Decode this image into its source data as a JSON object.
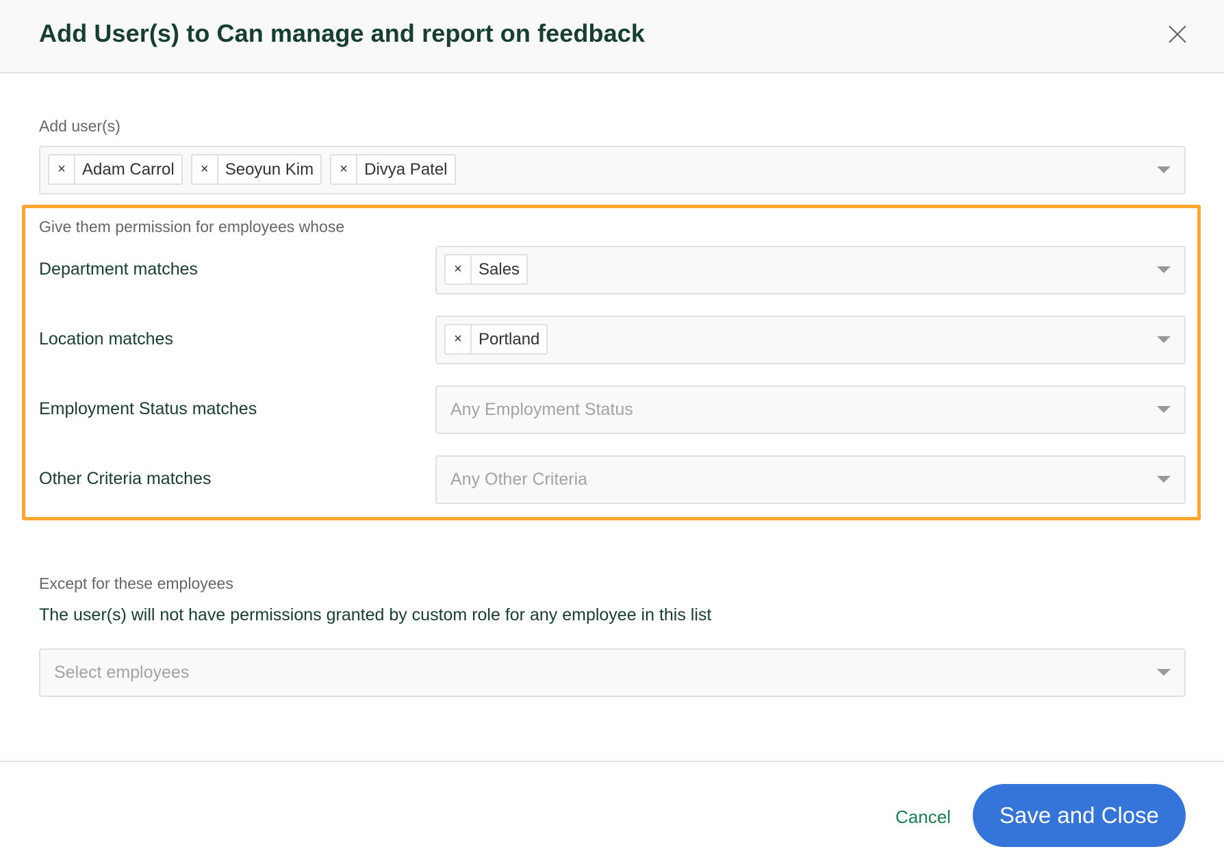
{
  "modal": {
    "title": "Add User(s) to Can manage and report on feedback",
    "close_icon": "close-icon"
  },
  "add_users": {
    "label": "Add user(s)",
    "selected": [
      {
        "name": "Adam Carrol",
        "remove": "×"
      },
      {
        "name": "Seoyun Kim",
        "remove": "×"
      },
      {
        "name": "Divya Patel",
        "remove": "×"
      }
    ],
    "caret_icon": "caret-down-icon"
  },
  "permissions": {
    "heading": "Give them permission for employees whose",
    "highlight_color": "#ffa631",
    "rows": [
      {
        "label": "Department matches",
        "selected": [
          {
            "name": "Sales",
            "remove": "×"
          }
        ],
        "placeholder": ""
      },
      {
        "label": "Location matches",
        "selected": [
          {
            "name": "Portland",
            "remove": "×"
          }
        ],
        "placeholder": ""
      },
      {
        "label": "Employment Status matches",
        "selected": [],
        "placeholder": "Any Employment Status"
      },
      {
        "label": "Other Criteria matches",
        "selected": [],
        "placeholder": "Any Other Criteria"
      }
    ]
  },
  "exceptions": {
    "label": "Except for these employees",
    "description": "The user(s) will not have permissions granted by custom role for any employee in this list",
    "placeholder": "Select employees"
  },
  "footer": {
    "cancel_label": "Cancel",
    "save_label": "Save and Close",
    "save_color": "#3574d8",
    "cancel_color": "#1a7f4f"
  }
}
